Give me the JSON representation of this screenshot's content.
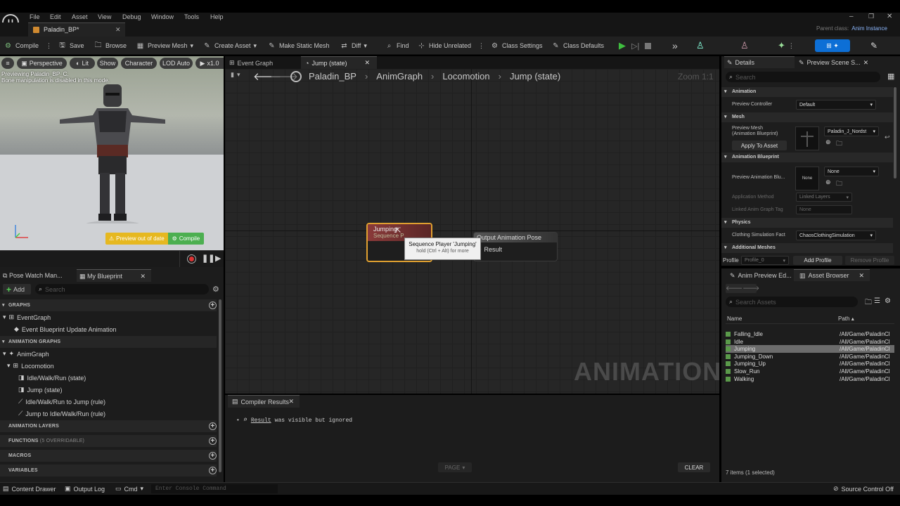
{
  "menu": [
    "File",
    "Edit",
    "Asset",
    "View",
    "Debug",
    "Window",
    "Tools",
    "Help"
  ],
  "doc_tab": "Paladin_BP*",
  "parent_class": {
    "label": "Parent class:",
    "value": "Anim Instance"
  },
  "toolbar": {
    "compile": "Compile",
    "save": "Save",
    "browse": "Browse",
    "preview_mesh": "Preview Mesh",
    "create_asset": "Create Asset",
    "make_static_mesh": "Make Static Mesh",
    "diff": "Diff",
    "find": "Find",
    "hide_unrelated": "Hide Unrelated",
    "class_settings": "Class Settings",
    "class_defaults": "Class Defaults"
  },
  "viewport": {
    "perspective": "Perspective",
    "lit": "Lit",
    "show": "Show",
    "character": "Character",
    "lod": "LOD Auto",
    "speed": "x1.0",
    "info1": "Previewing Paladin_BP_C.",
    "info2": "Bone manipulation is disabled in this mode.",
    "out_of_date": "Preview out of date",
    "compile": "Compile"
  },
  "left_tabs": {
    "pose_watch": "Pose Watch Man...",
    "my_blueprint": "My Blueprint"
  },
  "left": {
    "add": "Add",
    "search_placeholder": "Search",
    "graphs": "GRAPHS",
    "event_graph": "EventGraph",
    "event_update": "Event Blueprint Update Animation",
    "animation_graphs": "ANIMATION GRAPHS",
    "anim_graph": "AnimGraph",
    "locomotion": "Locomotion",
    "idle_state": "Idle/Walk/Run (state)",
    "jump_state": "Jump (state)",
    "rule1": "Idle/Walk/Run to Jump (rule)",
    "rule2": "Jump to Idle/Walk/Run (rule)",
    "anim_layers": "ANIMATION LAYERS",
    "functions": "FUNCTIONS",
    "functions_note": "(5 OVERRIDABLE)",
    "macros": "MACROS",
    "variables": "VARIABLES"
  },
  "graph_tabs": {
    "event_graph": "Event Graph",
    "jump_state": "Jump (state)"
  },
  "breadcrumbs": [
    "Paladin_BP",
    "AnimGraph",
    "Locomotion",
    "Jump (state)"
  ],
  "zoom": "Zoom 1:1",
  "nodes": {
    "jumping_title": "Jumping",
    "jumping_sub": "Sequence P",
    "output_title": "Output Animation Pose",
    "result": "Result",
    "tooltip_title": "Sequence Player 'Jumping'",
    "tooltip_hint": "hold (Ctrl + Alt) for more"
  },
  "watermark": "ANIMATION",
  "compiler": {
    "tab": "Compiler Results",
    "result_link": "Result",
    "message": "was visible but ignored",
    "page": "PAGE",
    "clear": "CLEAR"
  },
  "details": {
    "tab": "Details",
    "tab2": "Preview Scene S...",
    "search_placeholder": "Search",
    "animation": "Animation",
    "preview_controller": "Preview Controller",
    "preview_controller_value": "Default",
    "mesh": "Mesh",
    "preview_mesh": "Preview Mesh",
    "preview_mesh_sub": "(Animation Blueprint)",
    "mesh_value": "Paladin_J_Nordst",
    "apply_to_asset": "Apply To Asset",
    "animation_blueprint": "Animation Blueprint",
    "preview_anim_bp": "Preview Animation Blu...",
    "none_thumb": "None",
    "none_value": "None",
    "application_method": "Application Method",
    "linked_layers": "Linked Layers",
    "linked_anim_graph_tag": "Linked Anim Graph Tag",
    "tag_value": "None",
    "physics": "Physics",
    "cloth_sim": "Clothing Simulation Fact",
    "cloth_value": "ChaosClothingSimulation",
    "additional_meshes": "Additional Meshes",
    "profile_label": "Profile",
    "profile_value": "Profile_0",
    "add_profile": "Add Profile",
    "remove_profile": "Remove Profile"
  },
  "asset_tabs": {
    "anim_preview": "Anim Preview Ed...",
    "asset_browser": "Asset Browser"
  },
  "assets": {
    "search_placeholder": "Search Assets",
    "name_col": "Name",
    "path_col": "Path",
    "items": [
      {
        "name": "Falling_Idle",
        "path": "/All/Game/PaladinCl"
      },
      {
        "name": "Idle",
        "path": "/All/Game/PaladinCl"
      },
      {
        "name": "Jumping",
        "path": "/All/Game/PaladinCl"
      },
      {
        "name": "Jumping_Down",
        "path": "/All/Game/PaladinCl"
      },
      {
        "name": "Jumping_Up",
        "path": "/All/Game/PaladinCl"
      },
      {
        "name": "Slow_Run",
        "path": "/All/Game/PaladinCl"
      },
      {
        "name": "Walking",
        "path": "/All/Game/PaladinCl"
      }
    ],
    "count": "7 items (1 selected)"
  },
  "status": {
    "content_drawer": "Content Drawer",
    "output_log": "Output Log",
    "cmd": "Cmd",
    "console_placeholder": "Enter Console Command",
    "source_control": "Source Control Off"
  },
  "colors": {
    "accent": "#0d6fd6",
    "play": "#3fbf3f",
    "node_border": "#e0a030",
    "node_header": "#7a3a3a"
  }
}
